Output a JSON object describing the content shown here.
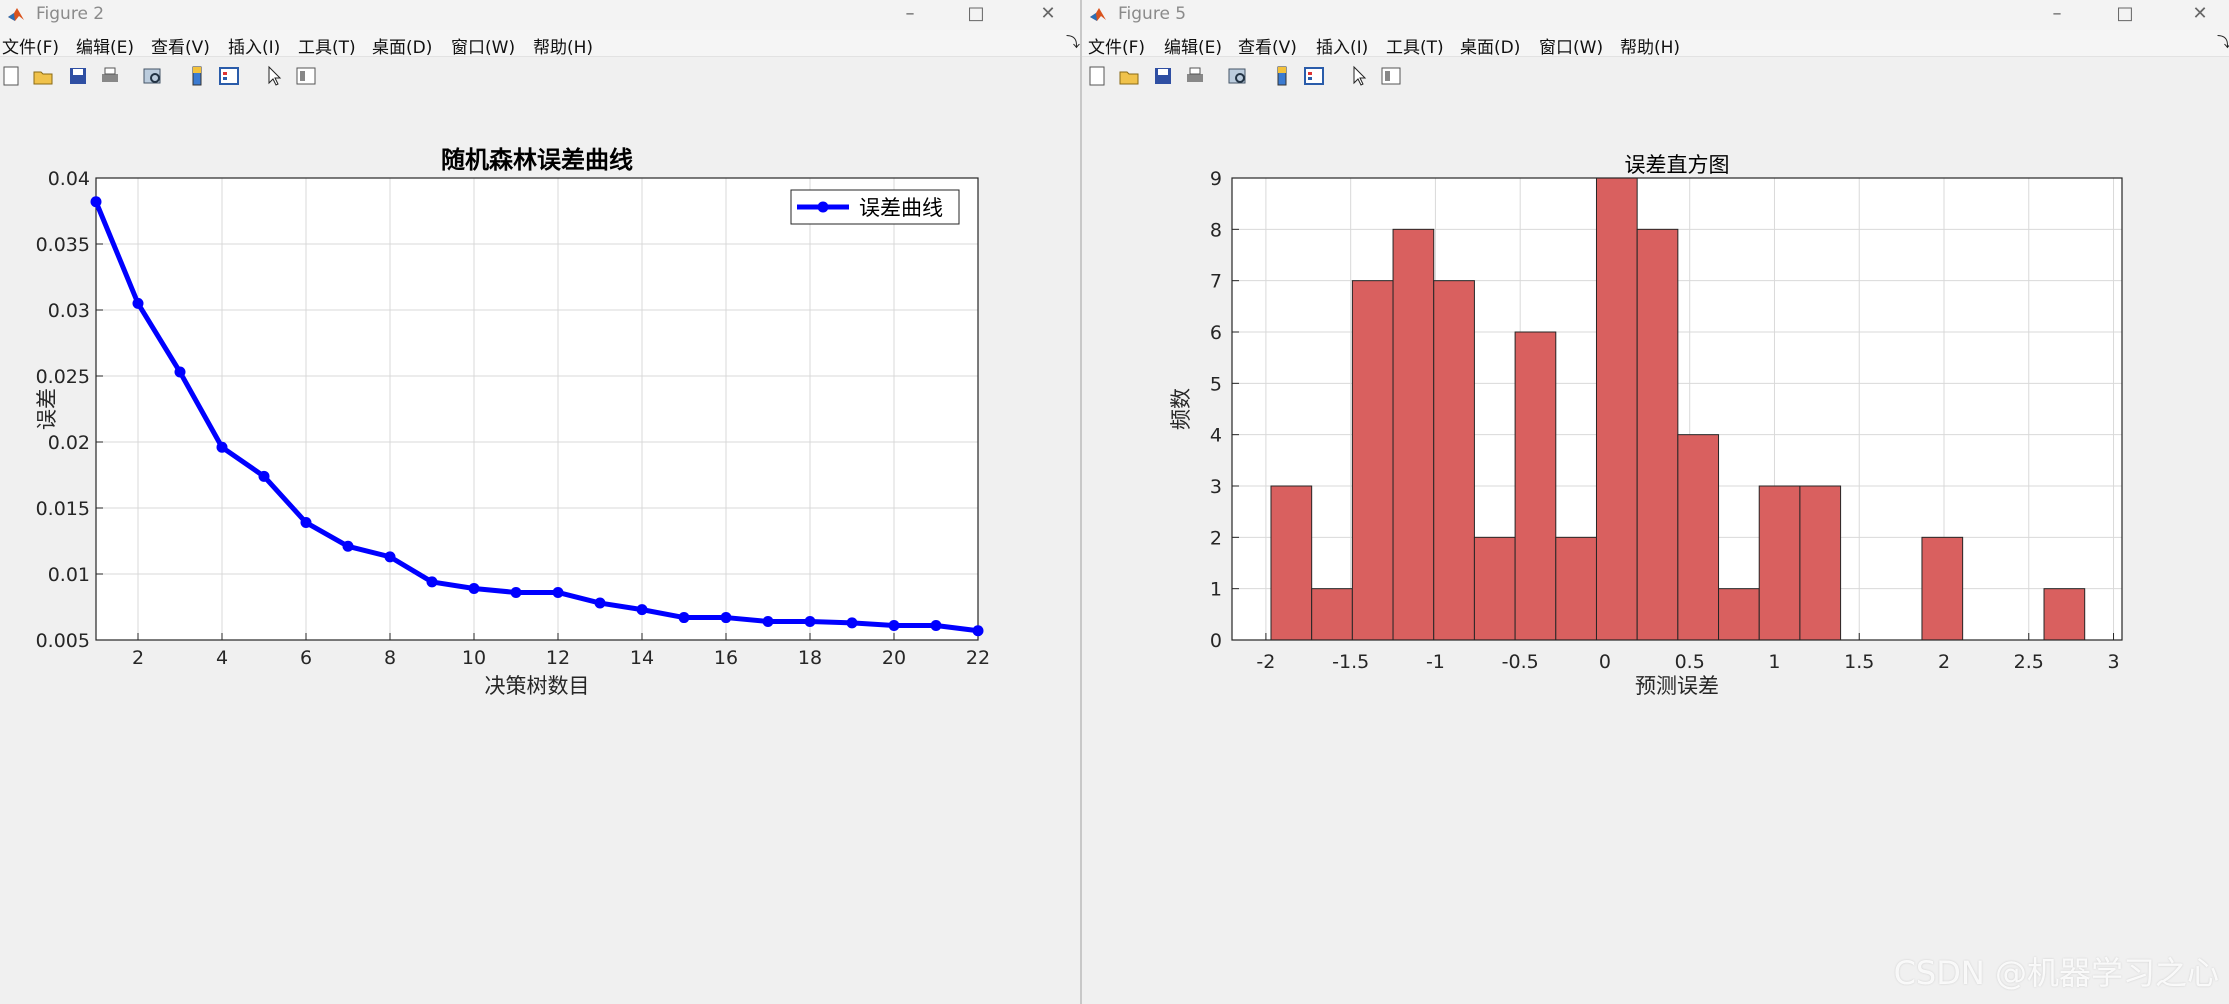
{
  "left_window": {
    "title": "Figure 2",
    "menus": [
      "文件(F)",
      "编辑(E)",
      "查看(V)",
      "插入(I)",
      "工具(T)",
      "桌面(D)",
      "窗口(W)",
      "帮助(H)"
    ],
    "toolbar_icons": [
      "new-figure-icon",
      "open-file-icon",
      "save-icon",
      "print-icon",
      "print-preview-icon",
      "colorbar-icon",
      "legend-icon",
      "pointer-icon",
      "property-inspector-icon"
    ]
  },
  "right_window": {
    "title": "Figure 5",
    "menus": [
      "文件(F)",
      "编辑(E)",
      "查看(V)",
      "插入(I)",
      "工具(T)",
      "桌面(D)",
      "窗口(W)",
      "帮助(H)"
    ],
    "toolbar_icons": [
      "new-figure-icon",
      "open-file-icon",
      "save-icon",
      "print-icon",
      "print-preview-icon",
      "colorbar-icon",
      "legend-icon",
      "pointer-icon",
      "property-inspector-icon"
    ]
  },
  "chart_data": [
    {
      "type": "line",
      "title": "随机森林误差曲线",
      "xlabel": "决策树数目",
      "ylabel": "误差",
      "xlim": [
        1,
        22
      ],
      "ylim": [
        0.005,
        0.04
      ],
      "xticks": [
        2,
        4,
        6,
        8,
        10,
        12,
        14,
        16,
        18,
        20,
        22
      ],
      "yticks": [
        0.005,
        0.01,
        0.015,
        0.02,
        0.025,
        0.03,
        0.035,
        0.04
      ],
      "grid": true,
      "legend_position": "top-right",
      "color": "#0000ff",
      "series": [
        {
          "name": "误差曲线",
          "x": [
            1,
            2,
            3,
            4,
            5,
            6,
            7,
            8,
            9,
            10,
            11,
            12,
            13,
            14,
            15,
            16,
            17,
            18,
            19,
            20,
            21,
            22
          ],
          "y": [
            0.0382,
            0.0305,
            0.0253,
            0.0196,
            0.0174,
            0.0139,
            0.0121,
            0.0113,
            0.0094,
            0.0089,
            0.0086,
            0.0086,
            0.0078,
            0.0073,
            0.0067,
            0.0067,
            0.0064,
            0.0064,
            0.0063,
            0.0061,
            0.0061,
            0.0057
          ]
        }
      ]
    },
    {
      "type": "bar",
      "title": "误差直方图",
      "xlabel": "预测误差",
      "ylabel": "频数",
      "xlim": [
        -2.2,
        3.05
      ],
      "ylim": [
        0,
        9
      ],
      "xticks": [
        -2,
        -1.5,
        -1,
        -0.5,
        0,
        0.5,
        1,
        1.5,
        2,
        2.5,
        3
      ],
      "yticks": [
        0,
        1,
        2,
        3,
        4,
        5,
        6,
        7,
        8,
        9
      ],
      "grid": true,
      "bar_color": "#d9605f",
      "bin_start": -1.97,
      "bin_width": 0.24,
      "counts": [
        3,
        1,
        7,
        8,
        7,
        2,
        6,
        2,
        9,
        8,
        4,
        1,
        3,
        3,
        0,
        0,
        2,
        0,
        0,
        1
      ]
    }
  ],
  "watermark": "CSDN @机器学习之心"
}
